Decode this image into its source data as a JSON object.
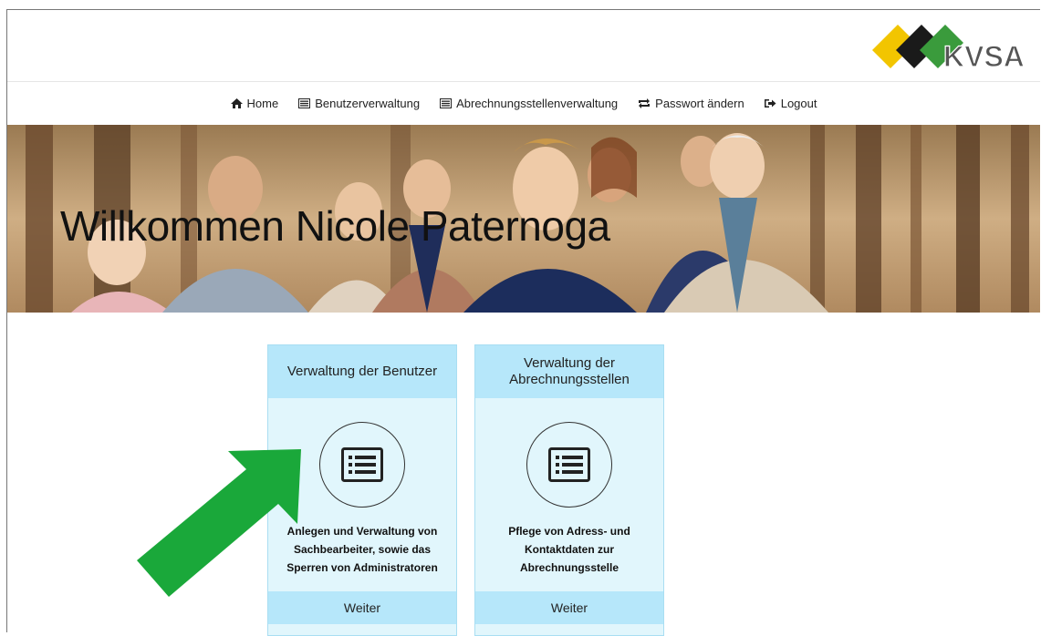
{
  "logo": {
    "text": "KVSA",
    "colors": [
      "#f2c500",
      "#1a1a1a",
      "#3a9b3c"
    ]
  },
  "nav": [
    {
      "label": "Home",
      "icon": "home-icon"
    },
    {
      "label": "Benutzerverwaltung",
      "icon": "list-icon"
    },
    {
      "label": "Abrechnungsstellenverwaltung",
      "icon": "list-icon"
    },
    {
      "label": "Passwort ändern",
      "icon": "retweet-icon"
    },
    {
      "label": "Logout",
      "icon": "logout-icon"
    }
  ],
  "hero": {
    "title": "Willkommen Nicole Paternoga"
  },
  "cards": [
    {
      "title": "Verwaltung der Benutzer",
      "icon": "list-alt-icon",
      "description": "Anlegen und Verwaltung von Sachbearbeiter, sowie das Sperren von Administratoren",
      "button": "Weiter"
    },
    {
      "title": "Verwaltung der Abrechnungsstellen",
      "icon": "list-alt-icon",
      "description": "Pflege von Adress- und Kontaktdaten zur Abrechnungsstelle",
      "button": "Weiter"
    }
  ],
  "annotation": {
    "icon": "green-arrow-icon",
    "color": "#1aa83a"
  }
}
